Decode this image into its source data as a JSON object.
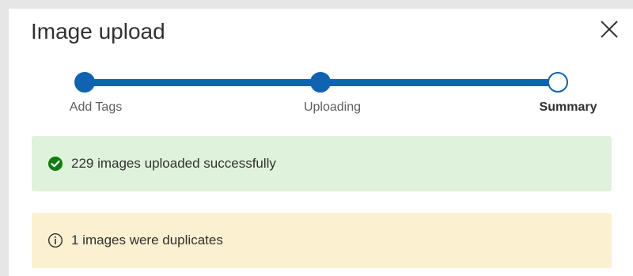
{
  "dialog": {
    "title": "Image upload",
    "close_icon": "close-icon"
  },
  "stepper": {
    "steps": [
      {
        "label": "Add Tags",
        "state": "completed"
      },
      {
        "label": "Uploading",
        "state": "completed"
      },
      {
        "label": "Summary",
        "state": "current"
      }
    ],
    "color": "#0f63b0"
  },
  "banners": {
    "success": {
      "icon": "check-circle-icon",
      "text": "229 images uploaded successfully",
      "color": "#dff3dc",
      "icon_color": "#107c10"
    },
    "warning": {
      "icon": "info-icon",
      "text": "1 images were duplicates",
      "color": "#fbf0d0"
    }
  }
}
